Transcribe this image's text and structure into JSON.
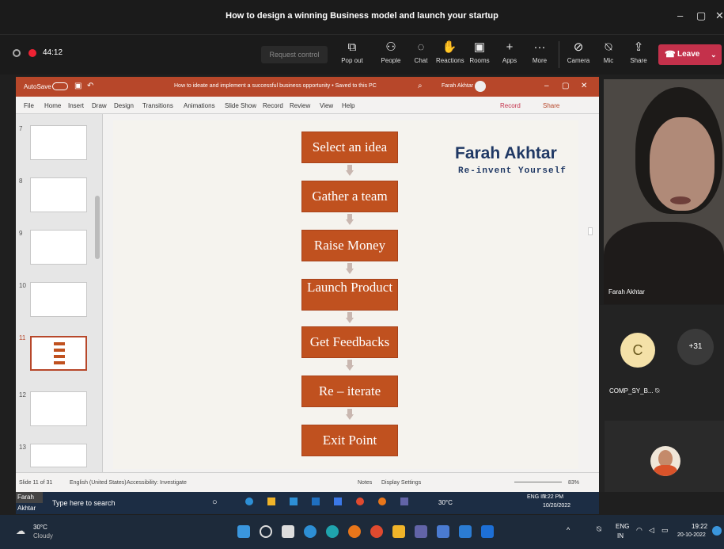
{
  "window": {
    "title": "How to design a winning Business model and launch your startup"
  },
  "meeting": {
    "timer": "44:12",
    "request_control": "Request control",
    "leave": "Leave",
    "toolbar": [
      {
        "label": "Pop out",
        "icon": "popout-icon"
      },
      {
        "label": "People",
        "icon": "people-icon"
      },
      {
        "label": "Chat",
        "icon": "chat-icon"
      },
      {
        "label": "Reactions",
        "icon": "reactions-icon"
      },
      {
        "label": "Rooms",
        "icon": "rooms-icon"
      },
      {
        "label": "Apps",
        "icon": "apps-icon"
      },
      {
        "label": "More",
        "icon": "more-icon"
      },
      {
        "label": "Camera",
        "icon": "camera-icon"
      },
      {
        "label": "Mic",
        "icon": "mic-icon"
      },
      {
        "label": "Share",
        "icon": "share-icon"
      }
    ]
  },
  "ppt": {
    "autosave": "AutoSave",
    "doc_title": "How to ideate and implement a successful business opportunity • Saved to this PC",
    "user": "Farah Akhtar",
    "menu": [
      "File",
      "Home",
      "Insert",
      "Draw",
      "Design",
      "Transitions",
      "Animations",
      "Slide Show",
      "Record",
      "Review",
      "View",
      "Help"
    ],
    "record_btn": "Record",
    "share_btn": "Share",
    "thumbs": [
      {
        "n": "7"
      },
      {
        "n": "8"
      },
      {
        "n": "9"
      },
      {
        "n": "10"
      },
      {
        "n": "11"
      },
      {
        "n": "12"
      },
      {
        "n": "13"
      }
    ],
    "status": {
      "slide": "Slide 11 of 31",
      "lang": "English (United States)",
      "access": "Accessibility: Investigate",
      "notes": "Notes",
      "display": "Display Settings",
      "zoom": "83%"
    }
  },
  "slide": {
    "steps": [
      "Select an idea",
      "Gather a team",
      "Raise Money",
      "Launch Product",
      "Get Feedbacks",
      "Re – iterate",
      "Exit Point"
    ],
    "name": "Farah Akhtar",
    "tagline": "Re-invent Yourself",
    "accent": "#c0511f",
    "name_color": "#1f3864"
  },
  "participants": {
    "presenter": "Farah Akhtar",
    "c_initial": "C",
    "c_name": "COMP_SY_B...",
    "more": "+31",
    "presenter_tag": "Farah Akhtar"
  },
  "inner_taskbar": {
    "search": "Type here to search",
    "weather": "30°C",
    "lang": "ENG IN",
    "time": "7:22 PM",
    "date": "10/20/2022"
  },
  "taskbar": {
    "weather_temp": "30°C",
    "weather_desc": "Cloudy",
    "lang": "ENG",
    "region": "IN",
    "time": "19:22",
    "date": "20-10-2022"
  }
}
